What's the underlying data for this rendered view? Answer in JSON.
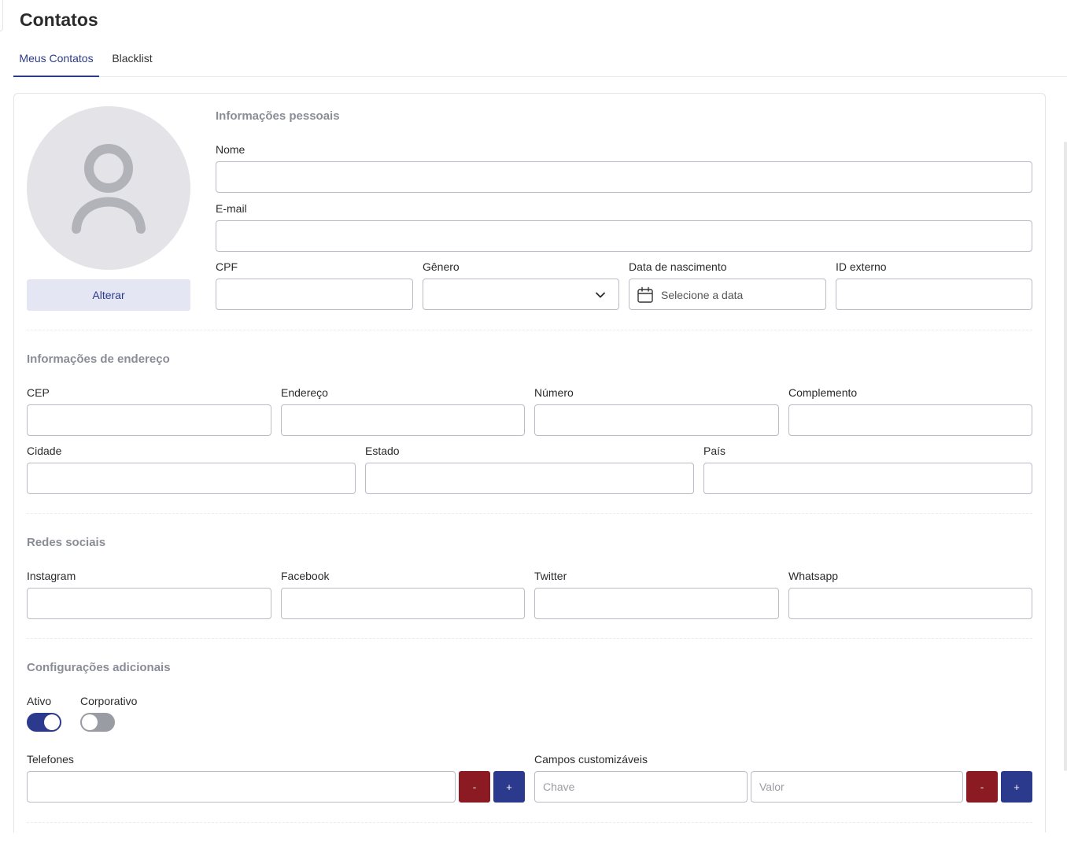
{
  "header": {
    "title": "Contatos"
  },
  "tabs": [
    {
      "label": "Meus Contatos",
      "active": true
    },
    {
      "label": "Blacklist",
      "active": false
    }
  ],
  "avatar": {
    "icon": "user-placeholder-icon",
    "change_label": "Alterar"
  },
  "personal": {
    "title": "Informações pessoais",
    "nome_label": "Nome",
    "email_label": "E-mail",
    "cpf_label": "CPF",
    "genero_label": "Gênero",
    "nascimento_label": "Data de nascimento",
    "nascimento_placeholder": "Selecione a data",
    "id_externo_label": "ID externo"
  },
  "address": {
    "title": "Informações de endereço",
    "cep_label": "CEP",
    "endereco_label": "Endereço",
    "numero_label": "Número",
    "complemento_label": "Complemento",
    "cidade_label": "Cidade",
    "estado_label": "Estado",
    "pais_label": "País"
  },
  "social": {
    "title": "Redes sociais",
    "instagram_label": "Instagram",
    "facebook_label": "Facebook",
    "twitter_label": "Twitter",
    "whatsapp_label": "Whatsapp"
  },
  "settings": {
    "title": "Configurações adicionais",
    "ativo_label": "Ativo",
    "ativo_on": true,
    "corporativo_label": "Corporativo",
    "corporativo_on": false,
    "telefones_label": "Telefones",
    "remove_label": "-",
    "add_label": "+",
    "custom_label": "Campos customizáveis",
    "chave_placeholder": "Chave",
    "valor_placeholder": "Valor"
  },
  "colors": {
    "primary": "#2b3a8c",
    "danger": "#8b1a22",
    "section_title": "#8a8d96"
  }
}
